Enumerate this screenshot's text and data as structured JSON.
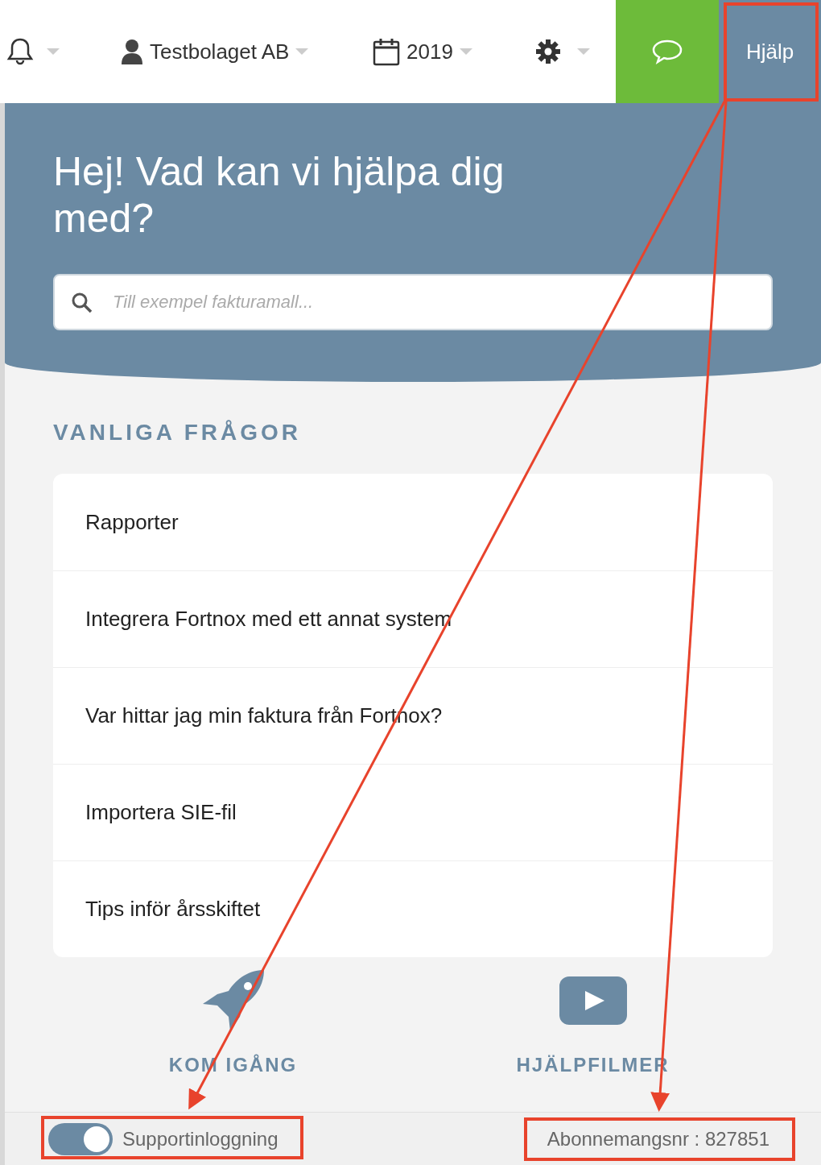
{
  "topbar": {
    "company": "Testbolaget AB",
    "year": "2019",
    "help": "Hjälp"
  },
  "help_panel": {
    "title": "Hej! Vad kan vi hjälpa dig med?",
    "search": {
      "placeholder": "Till exempel fakturamall..."
    },
    "faq_heading": "VANLIGA FRÅGOR",
    "faq": [
      "Rapporter",
      "Integrera Fortnox med ett annat system",
      "Var hittar jag min faktura från Fortnox?",
      "Importera SIE-fil",
      "Tips inför årsskiftet"
    ],
    "shortcuts": [
      {
        "kind": "rocket",
        "label": "KOM IGÅNG"
      },
      {
        "kind": "video",
        "label": "HJÄLPFILMER"
      }
    ]
  },
  "footer": {
    "support_login": {
      "label": "Supportinloggning",
      "on": true
    },
    "subscription": "Abonnemangsnr : 827851"
  }
}
